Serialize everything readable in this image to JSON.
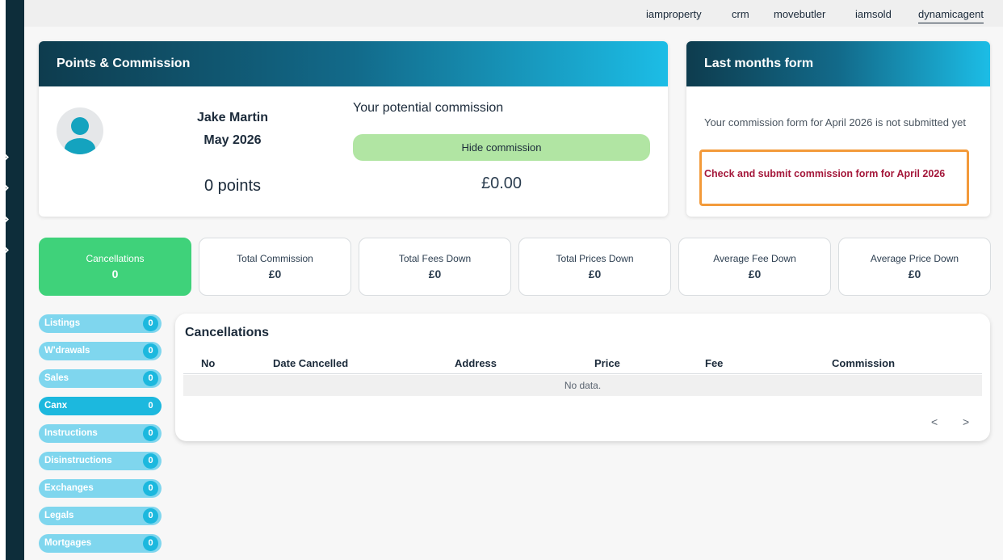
{
  "topnav": [
    "iamproperty",
    "crm",
    "movebutler",
    "iamsold",
    "dynamicagent"
  ],
  "points_card": {
    "title": "Points & Commission",
    "name": "Jake Martin",
    "period": "May 2026",
    "points": "0 points",
    "commission_title": "Your potential commission",
    "hide_button": "Hide commission",
    "amount": "£0.00"
  },
  "form_card": {
    "title": "Last months form",
    "message": "Your commission form for April 2026 is not submitted yet",
    "link": "Check and submit commission form for April 2026"
  },
  "stats": [
    {
      "label": "Cancellations",
      "value": "0"
    },
    {
      "label": "Total Commission",
      "value": "£0"
    },
    {
      "label": "Total Fees Down",
      "value": "£0"
    },
    {
      "label": "Total Prices Down",
      "value": "£0"
    },
    {
      "label": "Average Fee Down",
      "value": "£0"
    },
    {
      "label": "Average Price Down",
      "value": "£0"
    }
  ],
  "side_pills": [
    {
      "label": "Listings",
      "count": "0"
    },
    {
      "label": "W'drawals",
      "count": "0"
    },
    {
      "label": "Sales",
      "count": "0"
    },
    {
      "label": "Canx",
      "count": "0"
    },
    {
      "label": "Instructions",
      "count": "0"
    },
    {
      "label": "Disinstructions",
      "count": "0"
    },
    {
      "label": "Exchanges",
      "count": "0"
    },
    {
      "label": "Legals",
      "count": "0"
    },
    {
      "label": "Mortgages",
      "count": "0"
    }
  ],
  "table": {
    "title": "Cancellations",
    "columns": [
      "No",
      "Date Cancelled",
      "Address",
      "Price",
      "Fee",
      "Commission"
    ],
    "empty": "No data.",
    "prev": "<",
    "next": ">"
  },
  "colors": {
    "accent": "#1cb8de",
    "active_stat": "#3fd27a",
    "alert": "#a4173a",
    "highlight_border": "#f39a3a"
  }
}
